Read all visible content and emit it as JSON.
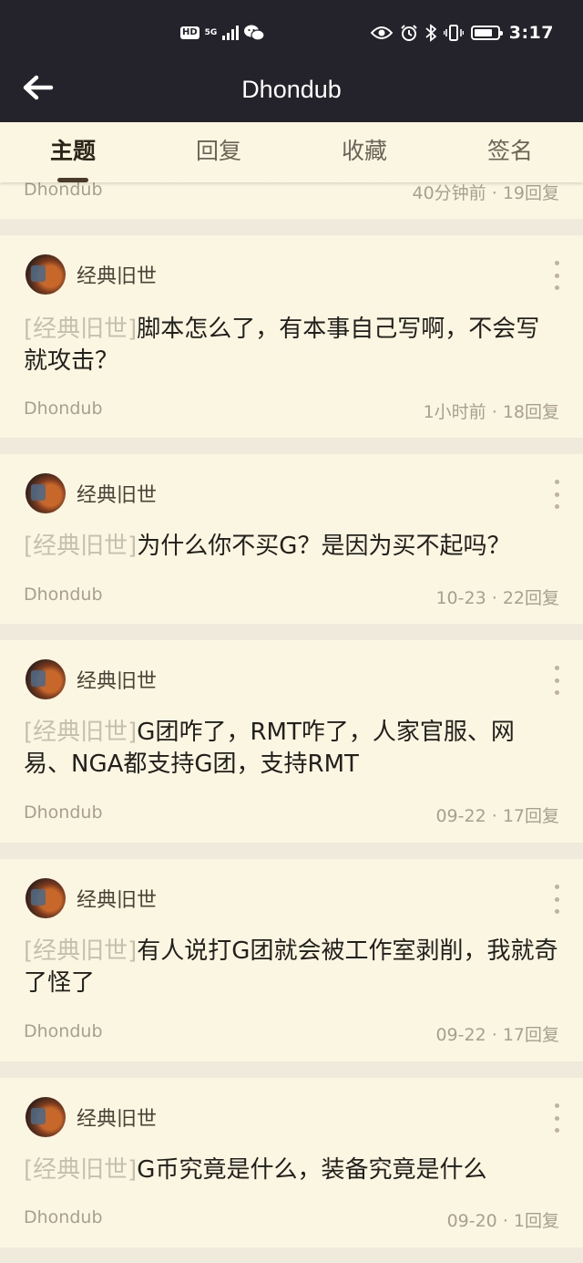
{
  "status_bar": {
    "hd": "HD",
    "network": "5G",
    "time": "3:17"
  },
  "header": {
    "title": "Dhondub"
  },
  "tabs": [
    {
      "label": "主题",
      "active": true
    },
    {
      "label": "回复",
      "active": false
    },
    {
      "label": "收藏",
      "active": false
    },
    {
      "label": "签名",
      "active": false
    }
  ],
  "posts": [
    {
      "author": "",
      "tag": "",
      "text": "",
      "board": "Dhondub",
      "time": "40分钟前",
      "replies": "19回复"
    },
    {
      "author": "经典旧世",
      "tag": "[经典旧世]",
      "text": "脚本怎么了，有本事自己写啊，不会写就攻击？",
      "board": "Dhondub",
      "time": "1小时前",
      "replies": "18回复"
    },
    {
      "author": "经典旧世",
      "tag": "[经典旧世]",
      "text": "为什么你不买G？是因为买不起吗？",
      "board": "Dhondub",
      "time": "10-23",
      "replies": "22回复"
    },
    {
      "author": "经典旧世",
      "tag": "[经典旧世]",
      "text": "G团咋了，RMT咋了，人家官服、网易、NGA都支持G团，支持RMT",
      "board": "Dhondub",
      "time": "09-22",
      "replies": "17回复"
    },
    {
      "author": "经典旧世",
      "tag": "[经典旧世]",
      "text": "有人说打G团就会被工作室剥削，我就奇了怪了",
      "board": "Dhondub",
      "time": "09-22",
      "replies": "17回复"
    },
    {
      "author": "经典旧世",
      "tag": "[经典旧世]",
      "text": "G币究竟是什么，装备究竟是什么",
      "board": "Dhondub",
      "time": "09-20",
      "replies": "1回复"
    }
  ],
  "meta_separator": " · ",
  "colors": {
    "header_bg": "#24222a",
    "card_bg": "#fbf6e2",
    "page_bg": "#efeadb",
    "tag_color": "#c6bfae"
  }
}
